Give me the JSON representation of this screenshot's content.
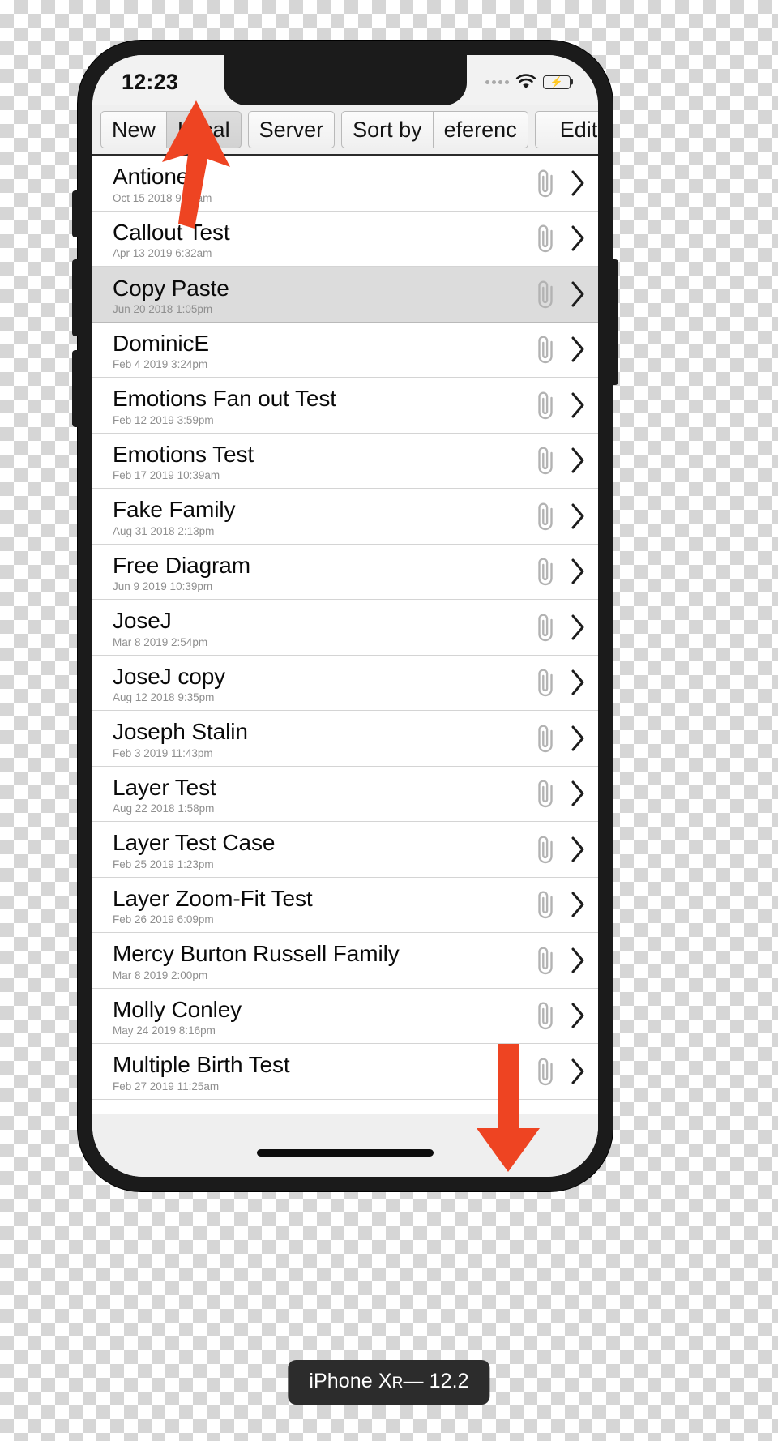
{
  "device": {
    "caption_prefix": "iPhone X",
    "caption_model_sub": "R",
    "caption_suffix": " — 12.2"
  },
  "status_bar": {
    "time": "12:23",
    "signal_icon": "signal-dots-icon",
    "wifi_icon": "wifi-icon",
    "battery_icon": "battery-charging-icon",
    "battery_level_percent": 100
  },
  "toolbar": {
    "buttons": [
      {
        "label": "New",
        "name": "new-button",
        "selected": false,
        "group": 0
      },
      {
        "label": "Local",
        "name": "local-button",
        "selected": true,
        "group": 0
      },
      {
        "label": "Server",
        "name": "server-button",
        "selected": false,
        "group": 1
      },
      {
        "label": "Sort by",
        "name": "sort-by-button",
        "selected": false,
        "group": 2
      },
      {
        "label": "eferenc",
        "name": "reference-button",
        "selected": false,
        "group": 2
      },
      {
        "label": "Edit",
        "name": "edit-button",
        "selected": false,
        "group": 3
      }
    ]
  },
  "list": {
    "accessory_attachment_icon": "paperclip-icon",
    "accessory_disclosure_icon": "chevron-right-icon",
    "rows": [
      {
        "title": "AntioneF",
        "date": "Oct 15 2018 9:34am",
        "selected": false
      },
      {
        "title": "Callout Test",
        "date": "Apr 13 2019 6:32am",
        "selected": false
      },
      {
        "title": "Copy Paste",
        "date": "Jun 20 2018 1:05pm",
        "selected": true
      },
      {
        "title": "DominicE",
        "date": "Feb 4 2019 3:24pm",
        "selected": false
      },
      {
        "title": "Emotions Fan out Test",
        "date": "Feb 12 2019 3:59pm",
        "selected": false
      },
      {
        "title": "Emotions Test",
        "date": "Feb 17 2019 10:39am",
        "selected": false
      },
      {
        "title": "Fake Family",
        "date": "Aug 31 2018 2:13pm",
        "selected": false
      },
      {
        "title": "Free Diagram",
        "date": "Jun 9 2019 10:39pm",
        "selected": false
      },
      {
        "title": "JoseJ",
        "date": "Mar 8 2019 2:54pm",
        "selected": false
      },
      {
        "title": "JoseJ copy",
        "date": "Aug 12 2018 9:35pm",
        "selected": false
      },
      {
        "title": "Joseph Stalin",
        "date": "Feb 3 2019 11:43pm",
        "selected": false
      },
      {
        "title": "Layer Test",
        "date": "Aug 22 2018 1:58pm",
        "selected": false
      },
      {
        "title": "Layer Test Case",
        "date": "Feb 25 2019 1:23pm",
        "selected": false
      },
      {
        "title": "Layer Zoom-Fit Test",
        "date": "Feb 26 2019 6:09pm",
        "selected": false
      },
      {
        "title": "Mercy Burton Russell Family",
        "date": "Mar 8 2019 2:00pm",
        "selected": false
      },
      {
        "title": "Molly Conley",
        "date": "May 24 2019 8:16pm",
        "selected": false
      },
      {
        "title": "Multiple Birth Test",
        "date": "Feb 27 2019 11:25am",
        "selected": false
      }
    ]
  },
  "annotations": {
    "arrow_color": "#EE4422",
    "arrow_up_name": "annotation-arrow-up",
    "arrow_down_name": "annotation-arrow-down"
  },
  "home_indicator": {
    "name": "home-indicator"
  }
}
